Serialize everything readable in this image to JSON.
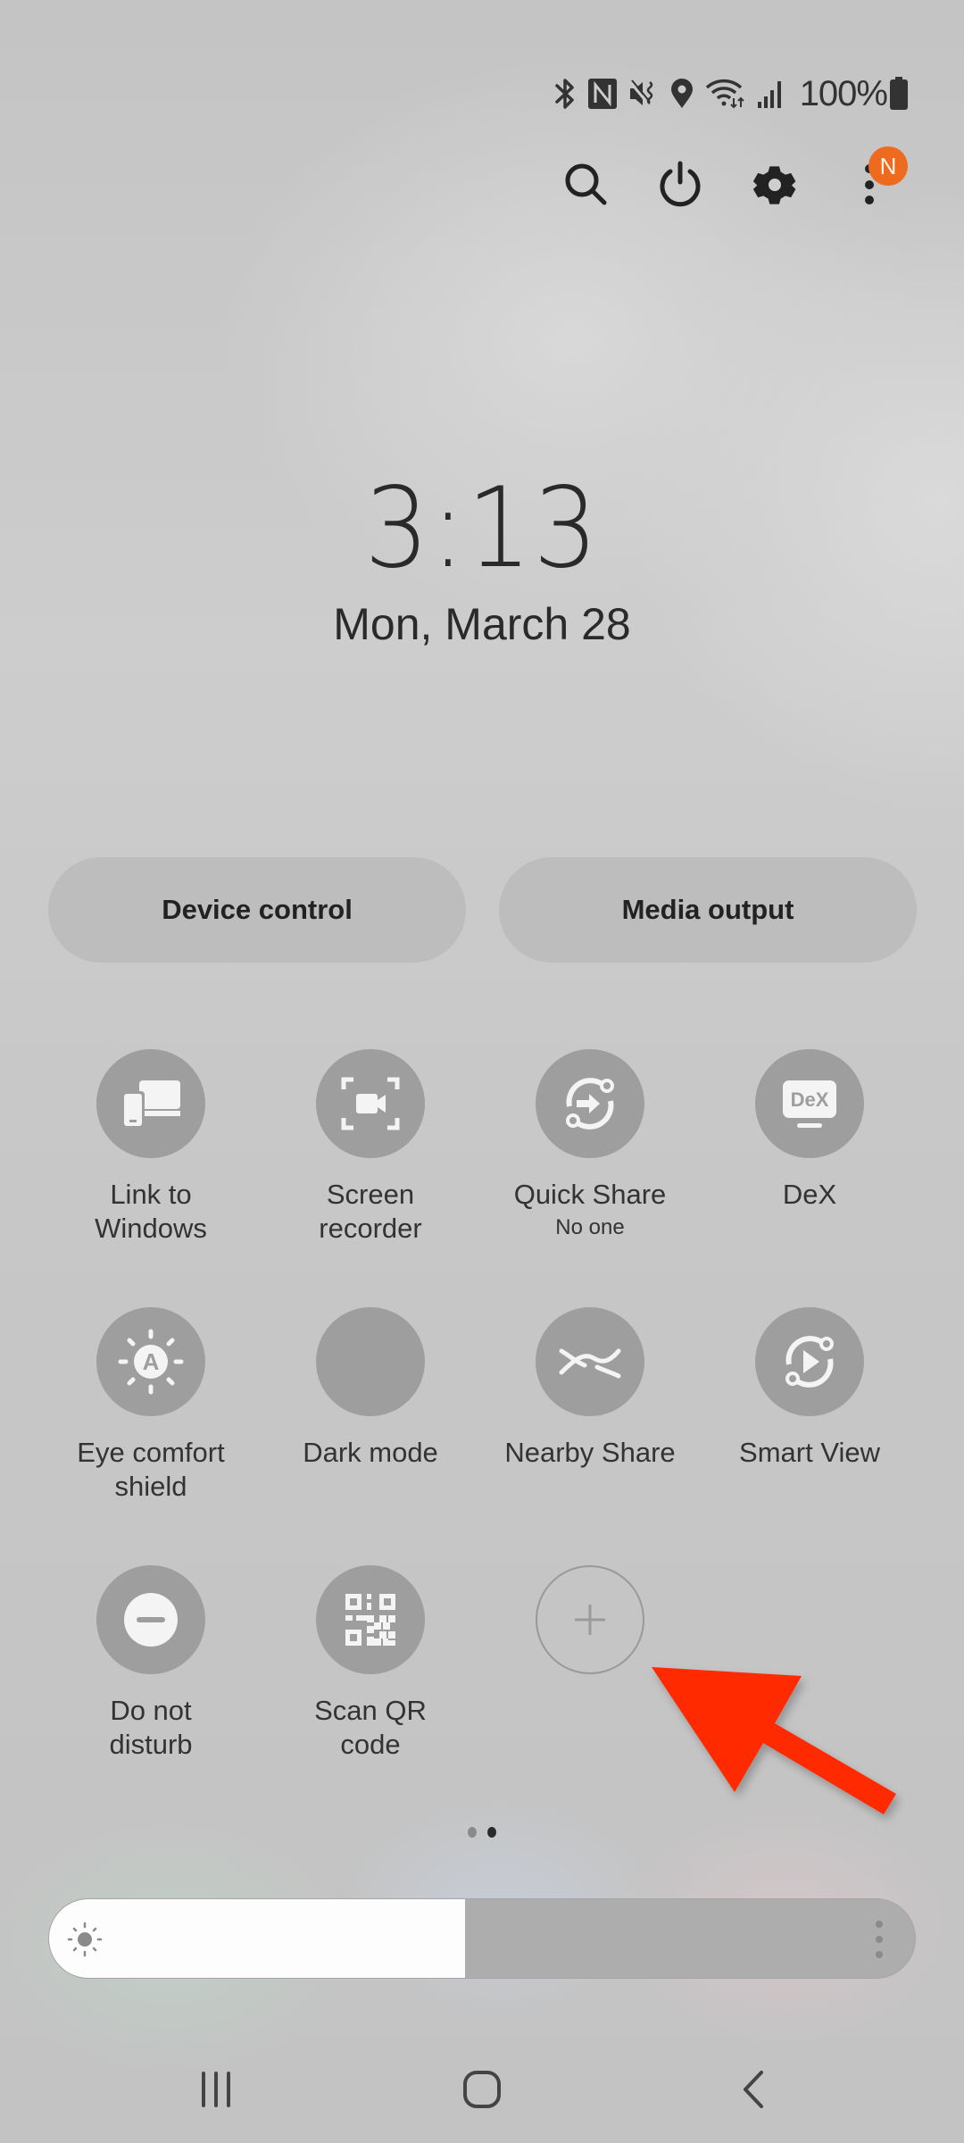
{
  "status_bar": {
    "icons": [
      "bluetooth-icon",
      "nfc-icon",
      "mute-vibrate-icon",
      "location-icon",
      "wifi-icon",
      "signal-icon",
      "battery-icon"
    ],
    "battery_text": "100%"
  },
  "top_actions": {
    "icons": [
      "search-icon",
      "power-icon",
      "settings-icon",
      "more-options-icon"
    ],
    "notification_badge": "N",
    "badge_color": "#ee6a1e"
  },
  "clock": {
    "time": "3:13",
    "date": "Mon, March 28"
  },
  "buttons": {
    "device_control": "Device control",
    "media_output": "Media output"
  },
  "tiles": [
    {
      "label": "Link to\nWindows",
      "line1": "Link to",
      "line2": "Windows",
      "icon": "link-to-windows-icon"
    },
    {
      "label": "Screen\nrecorder",
      "line1": "Screen",
      "line2": "recorder",
      "icon": "screen-recorder-icon"
    },
    {
      "label": "Quick Share",
      "line1": "Quick Share",
      "sub": "No one",
      "icon": "quick-share-icon"
    },
    {
      "label": "DeX",
      "line1": "DeX",
      "icon": "dex-icon",
      "icon_text": "DeX"
    },
    {
      "label": "Eye comfort\nshield",
      "line1": "Eye comfort",
      "line2": "shield",
      "icon": "eye-comfort-icon",
      "icon_text": "A"
    },
    {
      "label": "Dark mode",
      "line1": "Dark mode",
      "icon": "dark-mode-icon"
    },
    {
      "label": "Nearby Share",
      "line1": "Nearby Share",
      "icon": "nearby-share-icon"
    },
    {
      "label": "Smart View",
      "line1": "Smart View",
      "icon": "smart-view-icon"
    },
    {
      "label": "Do not\ndisturb",
      "line1": "Do not",
      "line2": "disturb",
      "icon": "do-not-disturb-icon"
    },
    {
      "label": "Scan QR\ncode",
      "line1": "Scan QR",
      "line2": "code",
      "icon": "qr-code-icon"
    },
    {
      "label": "",
      "icon": "add-icon"
    }
  ],
  "pager": {
    "pages": 2,
    "current": 2
  },
  "brightness": {
    "level_percent": 48,
    "icon": "brightness-icon",
    "more_icon": "more-options-icon"
  },
  "annotation": {
    "type": "arrow",
    "color": "#ff2a00",
    "points_to": "add-tile-button"
  },
  "nav_bar": {
    "icons": [
      "recent-apps-icon",
      "home-icon",
      "back-icon"
    ]
  }
}
